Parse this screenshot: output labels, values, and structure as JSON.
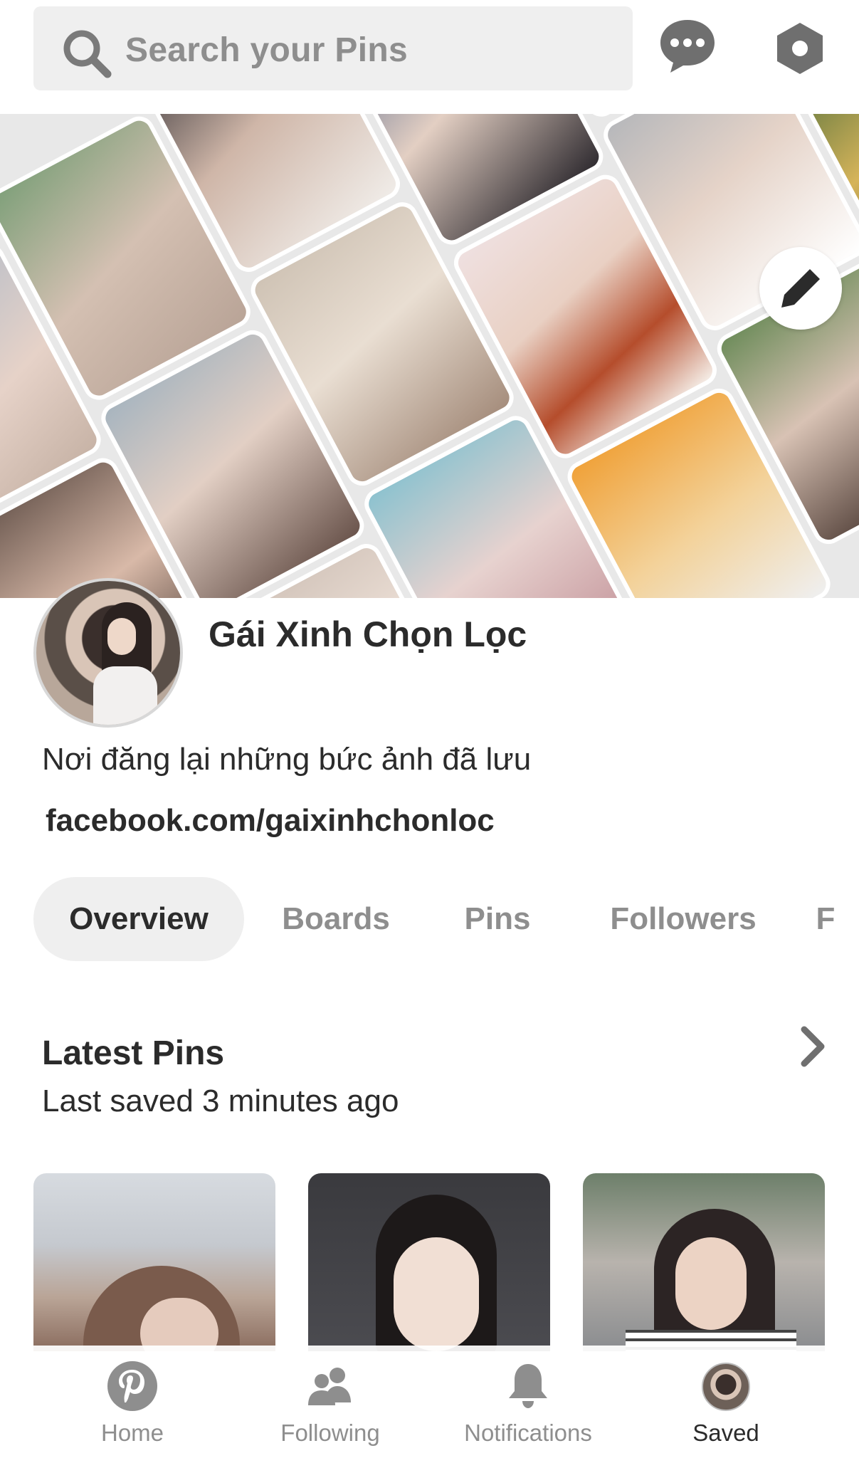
{
  "search": {
    "placeholder": "Search your Pins"
  },
  "header": {
    "messages_icon": "chat-bubble-icon",
    "settings_icon": "hexagon-settings-icon"
  },
  "cover": {
    "edit_icon": "pencil-icon"
  },
  "profile": {
    "name": "Gái Xinh Chọn Lọc",
    "description": "Nơi đăng lại những bức ảnh đã lưu",
    "link": "facebook.com/gaixinhchonloc"
  },
  "tabs": [
    {
      "label": "Overview",
      "active": true
    },
    {
      "label": "Boards",
      "active": false
    },
    {
      "label": "Pins",
      "active": false
    },
    {
      "label": "Followers",
      "active": false
    },
    {
      "label": "F",
      "active": false
    }
  ],
  "latest_pins": {
    "title": "Latest Pins",
    "subtitle": "Last saved 3 minutes ago"
  },
  "bottom_nav": [
    {
      "label": "Home",
      "icon": "pinterest-logo-icon",
      "active": false
    },
    {
      "label": "Following",
      "icon": "people-icon",
      "active": false
    },
    {
      "label": "Notifications",
      "icon": "bell-icon",
      "active": false
    },
    {
      "label": "Saved",
      "icon": "profile-avatar",
      "active": true
    }
  ]
}
